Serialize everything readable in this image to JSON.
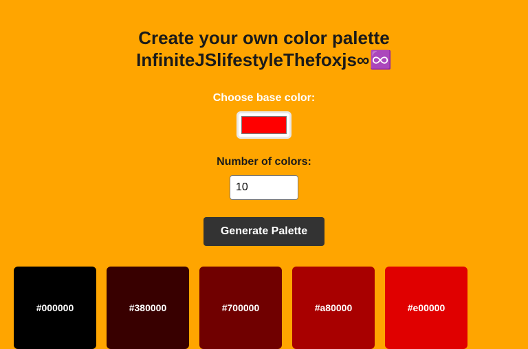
{
  "header": {
    "title_line1": "Create your own color palette",
    "title_line2": "InfiniteJSlifestyleThefoxjs∞♾️"
  },
  "base_color": {
    "label": "Choose base color:",
    "value": "#ff0000"
  },
  "num_colors": {
    "label": "Number of colors:",
    "value": "10"
  },
  "generate_button": {
    "label": "Generate Palette"
  },
  "palette": [
    {
      "hex": "#000000",
      "label": "#000000"
    },
    {
      "hex": "#380000",
      "label": "#380000"
    },
    {
      "hex": "#700000",
      "label": "#700000"
    },
    {
      "hex": "#a80000",
      "label": "#a80000"
    },
    {
      "hex": "#e00000",
      "label": "#e00000"
    }
  ],
  "colors": {
    "page_background": "#ffa500",
    "button_background": "#333333"
  }
}
